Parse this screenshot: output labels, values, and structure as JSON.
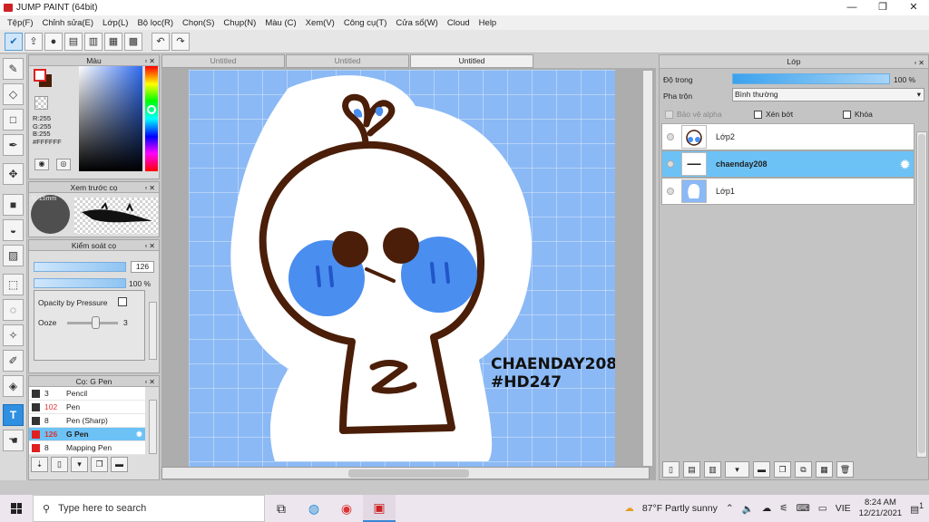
{
  "window": {
    "title": "JUMP PAINT (64bit)",
    "controls": [
      "—",
      "❐",
      "✕"
    ]
  },
  "menu": [
    "Tệp(F)",
    "Chỉnh sửa(E)",
    "Lớp(L)",
    "Bộ lọc(R)",
    "Chọn(S)",
    "Chụp(N)",
    "Màu (C)",
    "Xem(V)",
    "Công cụ(T)",
    "Cửa sổ(W)",
    "Cloud",
    "Help"
  ],
  "color_panel": {
    "title": "Màu",
    "r": "R:255",
    "g": "G:255",
    "b": "B:255",
    "hex": "#FFFFFF",
    "fg_color": "#FFFFFF",
    "bg_color": "#4A1E08"
  },
  "brush_preview": {
    "title": "Xem trước cọ",
    "size_text": "9, 15mm"
  },
  "brush_control": {
    "title": "Kiểm soát cọ",
    "size_value": "126",
    "opacity_value": "100 %",
    "opacity_by_pressure": "Opacity by Pressure",
    "ooze_label": "Ooze",
    "ooze_value": "3"
  },
  "brush_list": {
    "title": "Cọ: G Pen",
    "items": [
      {
        "size": "3",
        "name": "Pencil",
        "color": "#333333"
      },
      {
        "size": "102",
        "name": "Pen",
        "color": "#333333"
      },
      {
        "size": "8",
        "name": "Pen (Sharp)",
        "color": "#333333"
      },
      {
        "size": "126",
        "name": "G Pen",
        "color": "#e02020",
        "selected": true
      },
      {
        "size": "8",
        "name": "Mapping Pen",
        "color": "#e02020"
      }
    ]
  },
  "tabs": [
    "Untitled",
    "Untitled",
    "Untitled"
  ],
  "artwork": {
    "text_line1": "CHAENDAY208",
    "text_line2": "#HD247"
  },
  "layers_panel": {
    "title": "Lớp",
    "opacity_label": "Độ trong",
    "opacity_value": "100 %",
    "blend_label": "Pha trộn",
    "blend_value": "Bình thường",
    "protect_alpha": "Bảo vệ alpha",
    "clip": "Xén bớt",
    "lock": "Khóa",
    "layers": [
      {
        "name": "Lớp2",
        "selected": false
      },
      {
        "name": "chaenday208",
        "selected": true
      },
      {
        "name": "Lớp1",
        "selected": false
      }
    ]
  },
  "taskbar": {
    "search_placeholder": "Type here to search",
    "weather": "87°F  Partly sunny",
    "lang": "VIE",
    "time": "8:24 AM",
    "date": "12/21/2021",
    "notif_count": "1"
  }
}
